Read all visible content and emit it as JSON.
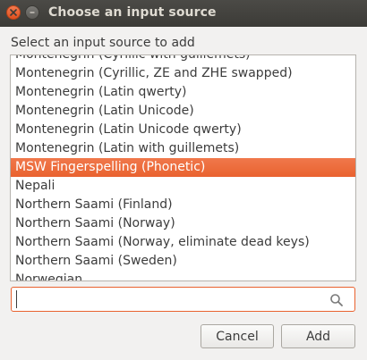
{
  "window": {
    "title": "Choose an input source"
  },
  "instruction": "Select an input source to add",
  "list": {
    "items": [
      {
        "label": "Montenegrin (Cyrillic with guillemets)",
        "selected": false
      },
      {
        "label": "Montenegrin (Cyrillic, ZE and ZHE swapped)",
        "selected": false
      },
      {
        "label": "Montenegrin (Latin qwerty)",
        "selected": false
      },
      {
        "label": "Montenegrin (Latin Unicode)",
        "selected": false
      },
      {
        "label": "Montenegrin (Latin Unicode qwerty)",
        "selected": false
      },
      {
        "label": "Montenegrin (Latin with guillemets)",
        "selected": false
      },
      {
        "label": "MSW Fingerspelling (Phonetic)",
        "selected": true
      },
      {
        "label": "Nepali",
        "selected": false
      },
      {
        "label": "Northern Saami (Finland)",
        "selected": false
      },
      {
        "label": "Northern Saami (Norway)",
        "selected": false
      },
      {
        "label": "Northern Saami (Norway, eliminate dead keys)",
        "selected": false
      },
      {
        "label": "Northern Saami (Sweden)",
        "selected": false
      },
      {
        "label": "Norwegian",
        "selected": false
      }
    ]
  },
  "search": {
    "value": "",
    "placeholder": ""
  },
  "buttons": {
    "cancel_label": "Cancel",
    "add_label": "Add"
  },
  "colors": {
    "accent": "#e9622f",
    "titlebar": "#3c3b37"
  }
}
